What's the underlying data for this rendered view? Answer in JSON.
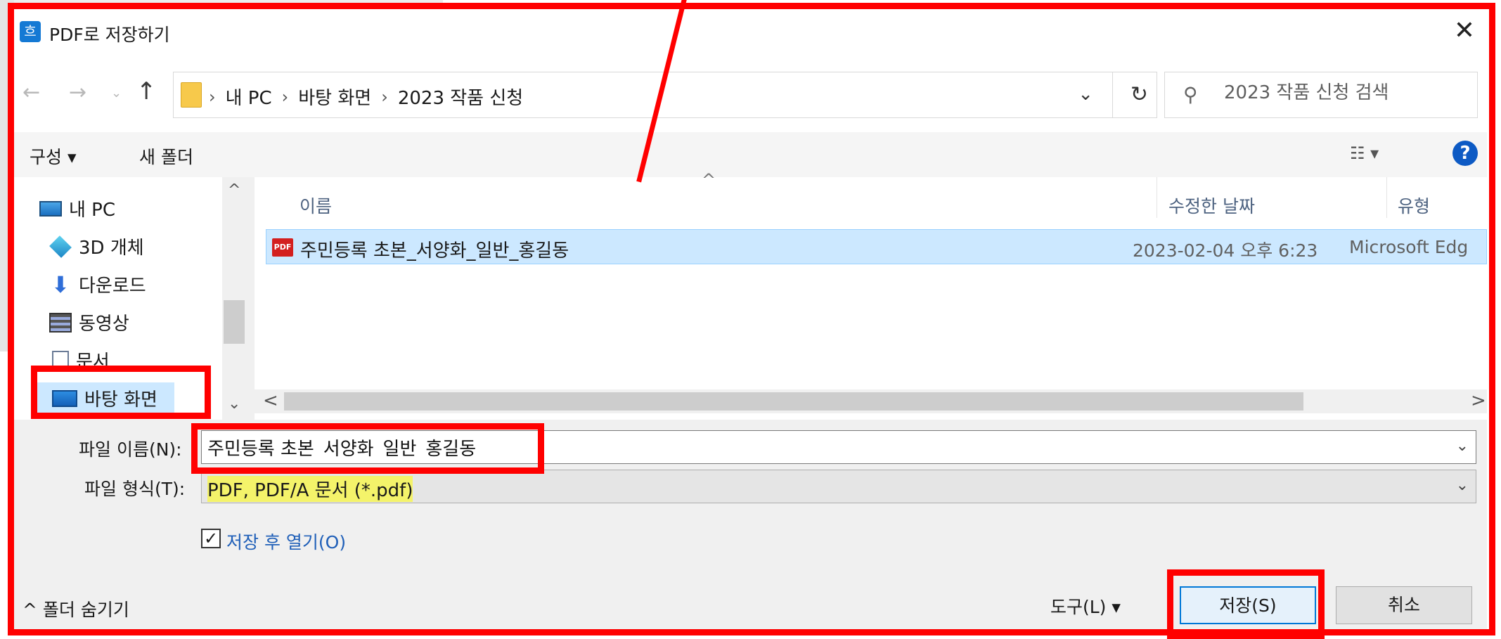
{
  "window": {
    "title": "PDF로 저장하기",
    "app_icon_glyph": "흐",
    "close_glyph": "✕"
  },
  "nav": {
    "back_glyph": "←",
    "forward_glyph": "→",
    "recent_glyph": "⌄",
    "up_glyph": "↑",
    "breadcrumbs": [
      "내 PC",
      "바탕 화면",
      "2023 작품 신청"
    ],
    "separator": "›",
    "dropdown_glyph": "⌄",
    "refresh_glyph": "↻"
  },
  "search": {
    "placeholder": "2023 작품 신청 검색",
    "icon_glyph": "⚲"
  },
  "toolbar": {
    "organize_label": "구성 ▾",
    "new_folder_label": "새 폴더",
    "view_label": "☷ ▾",
    "help_label": "?"
  },
  "sidebar": {
    "items": [
      {
        "label": "내 PC",
        "icon": "pc-icon"
      },
      {
        "label": "3D 개체",
        "icon": "3d-objects-icon"
      },
      {
        "label": "다운로드",
        "icon": "download-icon"
      },
      {
        "label": "동영상",
        "icon": "video-icon"
      },
      {
        "label": "문서",
        "icon": "document-icon"
      },
      {
        "label": "바탕 화면",
        "icon": "desktop-icon"
      }
    ],
    "scroll_up_glyph": "^",
    "scroll_down_glyph": "⌄"
  },
  "filelist": {
    "sort_glyph": "^",
    "columns": [
      "이름",
      "수정한 날짜",
      "유형"
    ],
    "rows": [
      {
        "icon": "pdf-icon",
        "icon_text": "PDF",
        "name": "주민등록 초본_서양화_일반_홍길동",
        "date": "2023-02-04 오후 6:23",
        "type": "Microsoft Edg"
      }
    ],
    "hscroll_left_glyph": "<",
    "hscroll_right_glyph": ">"
  },
  "form": {
    "filename_label": "파일 이름(N):",
    "filename_value": "주민등록 초본_서양화_일반_홍길동",
    "filetype_label": "파일 형식(T):",
    "filetype_value": "PDF, PDF/A 문서 (*.pdf)",
    "combo_glyph": "⌄",
    "open_after_save_label": "저장 후 열기(O)",
    "open_after_save_checked": true,
    "check_glyph": "✓"
  },
  "footer": {
    "hide_folders_label": "^ 폴더 숨기기",
    "tools_label": "도구(L)  ▾",
    "save_label": "저장(S)",
    "cancel_label": "취소"
  },
  "colors": {
    "annotation_red": "#ff0000",
    "selection_blue": "#cce8ff",
    "highlight_yellow": "#f4f36a",
    "accent": "#0078d7"
  }
}
